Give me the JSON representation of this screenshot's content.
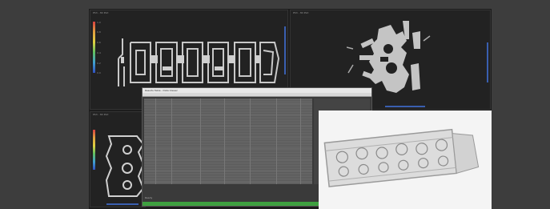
{
  "windows": {
    "top_left": {
      "title": "PS3 - 3D Plot",
      "legend_labels": [
        "1.0",
        "0.8",
        "0.6",
        "0.4",
        "0.2",
        "0.0"
      ]
    },
    "top_right": {
      "title": "PS3 - 3D Plot"
    },
    "bottom_left": {
      "title": "PS3 - 3D Plot"
    },
    "table": {
      "title": "Results Table - Data Viewer",
      "status": "Ready"
    },
    "bottom_right": {
      "title": ""
    }
  },
  "colors": {
    "background": "#3d3d3d",
    "plot_bg": "#222222",
    "accent": "#3a5fb0",
    "status_green": "#3ea040"
  }
}
